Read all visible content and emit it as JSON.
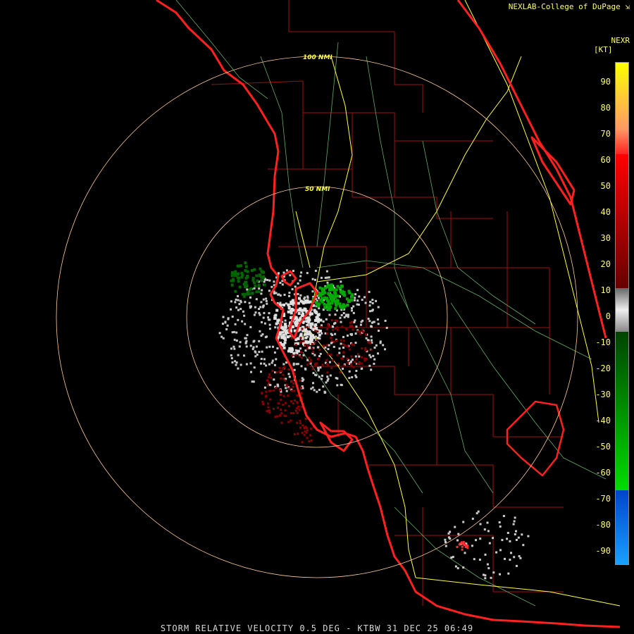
{
  "credit": "NEXLAB-College of DuPage",
  "product_code": "NEXR",
  "unit": "[KT]",
  "footer": "STORM RELATIVE VELOCITY 0.5 DEG - KTBW 31 DEC 25 06:49",
  "range_rings": [
    {
      "label": "100 NMI",
      "nmi": 100
    },
    {
      "label": "50 NMI",
      "nmi": 50
    }
  ],
  "legend": {
    "ticks": [
      "90",
      "80",
      "70",
      "60",
      "50",
      "40",
      "30",
      "20",
      "10",
      "0",
      "-10",
      "-20",
      "-30",
      "-40",
      "-50",
      "-60",
      "-70",
      "-80",
      "-90"
    ],
    "colors": {
      "yellow": "#ffff00",
      "orange": "#ff9966",
      "red": "#ff0000",
      "dark_red": "#8b0000",
      "gray": "#bbbbbb",
      "dark_green": "#006400",
      "green": "#00dd00",
      "blue": "#0044cc",
      "light_blue": "#1aa0ff"
    }
  },
  "map_colors": {
    "coastline": "#ff2020",
    "county_lines": "#a01010",
    "highways": "#ffff44",
    "roads": "#66aa66",
    "rings": "#ffcc99"
  }
}
